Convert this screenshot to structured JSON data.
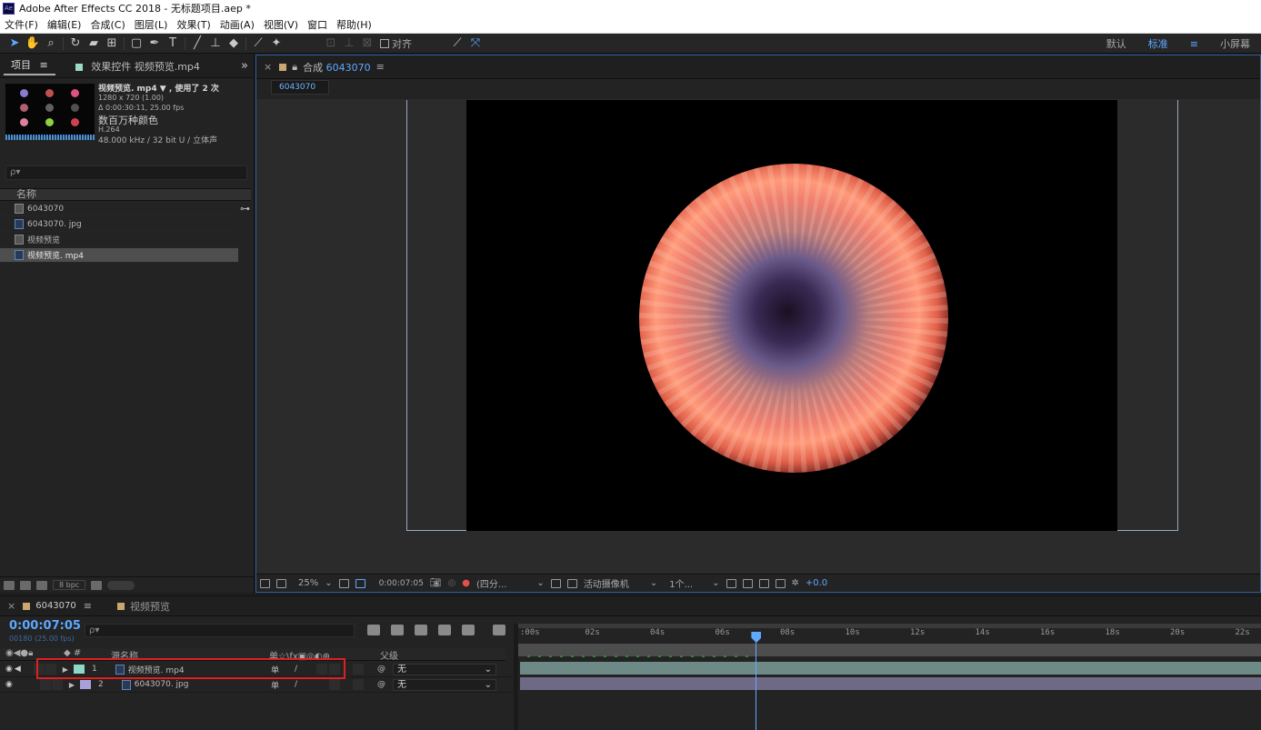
{
  "app": {
    "title": "Adobe After Effects CC 2018 - 无标题项目.aep *",
    "logo": "Ae"
  },
  "menu": [
    "文件(F)",
    "编辑(E)",
    "合成(C)",
    "图层(L)",
    "效果(T)",
    "动画(A)",
    "视图(V)",
    "窗口",
    "帮助(H)"
  ],
  "toolbar": {
    "align_label": "对齐",
    "workspaces": [
      "默认",
      "标准",
      "小屏幕"
    ],
    "active_workspace": "标准",
    "workspace_menu_icon": "≡"
  },
  "project": {
    "tab_label": "项目",
    "tab_menu": "≡",
    "effects_tab": "效果控件 视频预览.mp4",
    "expand_icon": "»",
    "selected_file": {
      "name": "视频预览. mp4 ▼ , 使用了 2 次",
      "dims": "1280 x 720 (1.00)",
      "duration": "Δ 0:00:30:11, 25.00 fps",
      "colors": "数百万种颜色",
      "codec": "H.264",
      "audio": "48.000 kHz / 32 bit U / 立体声"
    },
    "search_placeholder": "ρ▾",
    "column_name": "名称",
    "items": [
      {
        "name": "6043070",
        "type": "comp",
        "selected": false
      },
      {
        "name": "6043070. jpg",
        "type": "image",
        "selected": false
      },
      {
        "name": "视频预览",
        "type": "comp",
        "selected": false
      },
      {
        "name": "视频预览. mp4",
        "type": "video",
        "selected": true
      }
    ],
    "bpc_label": "8 bpc"
  },
  "composition": {
    "tab_label": "合成",
    "comp_name": "6043070",
    "sub_tab": "6043070",
    "zoom": "25%",
    "timecode": "0:00:07:05",
    "resolution": "(四分...",
    "camera": "活动摄像机",
    "views": "1个...",
    "exposure": "+0.0"
  },
  "timeline": {
    "tabs": [
      {
        "label": "6043070",
        "color": "#c8a870"
      },
      {
        "label": "视频预览",
        "color": "#c8a870"
      }
    ],
    "timecode": "0:00:07:05",
    "frames": "00180 (25.00 fps)",
    "search_placeholder": "ρ▾",
    "column_source": "源名称",
    "column_switches": "单☆\\fx▣◎◐⊕",
    "column_parent": "父级",
    "layers": [
      {
        "index": "1",
        "name": "视频预览. mp4",
        "color": "#8ed8c8",
        "parent": "无",
        "switch1": "单",
        "switch2": "/"
      },
      {
        "index": "2",
        "name": "6043070. jpg",
        "color": "#a8a0d8",
        "parent": "无",
        "switch1": "单",
        "switch2": "/"
      }
    ],
    "ruler_ticks": [
      ":00s",
      "02s",
      "04s",
      "06s",
      "08s",
      "10s",
      "12s",
      "14s",
      "16s",
      "18s",
      "20s",
      "22s"
    ],
    "playhead_seconds": 7.2
  },
  "colors": {
    "accent": "#5fa8ff",
    "highlight_box": "#e02020",
    "layer1_bar": "#6e8a86",
    "layer2_bar": "#6e6a86"
  }
}
